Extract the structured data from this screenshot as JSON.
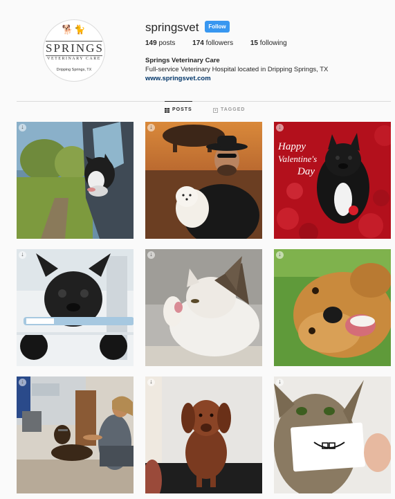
{
  "profile": {
    "logo": {
      "name": "SPRINGS",
      "subtitle": "VETERINARY CARE",
      "location": "Dripping Springs, TX"
    },
    "username": "springsvet",
    "follow_label": "Follow",
    "posts_count": "149",
    "posts_label": "posts",
    "followers_count": "174",
    "followers_label": "followers",
    "following_count": "15",
    "following_label": "following",
    "full_name": "Springs Veterinary Care",
    "bio": "Full-service Veterinary Hospital located in Dripping Springs, TX",
    "website": "www.springsvet.com"
  },
  "tabs": [
    {
      "label": "POSTS",
      "icon": "grid-icon",
      "active": true
    },
    {
      "label": "TAGGED",
      "icon": "tag-icon",
      "active": false
    }
  ],
  "valentine_text": [
    "Happy",
    "Valentine's",
    "Day"
  ],
  "posts": [
    {
      "subject": "french bulldog in car window"
    },
    {
      "subject": "man in cowboy hat holding white dog"
    },
    {
      "subject": "valentine french bulldog"
    },
    {
      "subject": "french bulldog with toothbrush"
    },
    {
      "subject": "cat licking paw"
    },
    {
      "subject": "golden retriever on grass"
    },
    {
      "subject": "dog laser therapy at clinic"
    },
    {
      "subject": "brown dog on exam table"
    },
    {
      "subject": "kitten with paper smile"
    }
  ],
  "colors": {
    "follow_button": "#3897f0",
    "link": "#003569",
    "background": "#fafafa"
  }
}
